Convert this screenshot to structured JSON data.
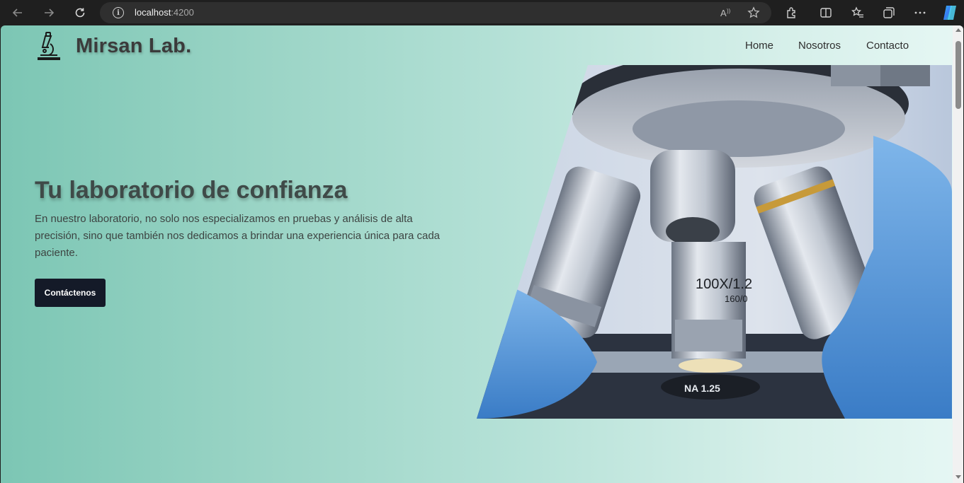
{
  "browser": {
    "url_host": "localhost",
    "url_port": ":4200",
    "icons": [
      "back-icon",
      "forward-icon",
      "reload-icon",
      "site-info-icon",
      "read-aloud-icon",
      "favorite-star-icon",
      "extensions-icon",
      "split-screen-icon",
      "favorites-icon",
      "collections-icon",
      "more-icon",
      "copilot-icon"
    ]
  },
  "header": {
    "brand": "Mirsan Lab.",
    "logo_icon": "microscope-icon",
    "nav": [
      {
        "label": "Home"
      },
      {
        "label": "Nosotros"
      },
      {
        "label": "Contacto"
      }
    ]
  },
  "hero": {
    "title": "Tu laboratorio de confianza",
    "description": "En nuestro laboratorio, no solo nos especializamos en pruebas y análisis de alta precisión, sino que también nos dedicamos a brindar una experiencia única para cada paciente.",
    "cta_label": "Contáctenos",
    "image_labels": {
      "objective": "100X/1.2",
      "tube": "160/0",
      "stage": "NA 1.25"
    }
  },
  "colors": {
    "bg_left": "#7cc6b4",
    "bg_right": "#e6f7f4",
    "cta_bg": "#141a28",
    "text": "#3b3b3b"
  }
}
